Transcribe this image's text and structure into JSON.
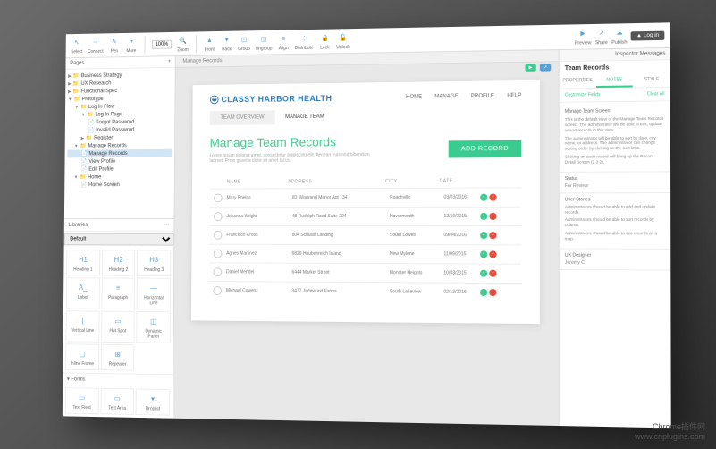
{
  "toolbar": {
    "select": "Select",
    "connect": "Connect",
    "pen": "Pen",
    "more": "More",
    "zoom_value": "100%",
    "zoom_label": "Zoom",
    "front": "Front",
    "back": "Back",
    "group": "Group",
    "ungroup": "Ungroup",
    "align": "Align",
    "distribute": "Distribute",
    "lock": "Lock",
    "unlock": "Unlock",
    "preview": "Preview",
    "share": "Share",
    "publish": "Publish",
    "login": "Log in"
  },
  "pages_header": "Pages",
  "tree": [
    {
      "label": "Business Strategy",
      "type": "folder",
      "level": 0
    },
    {
      "label": "UX Research",
      "type": "folder",
      "level": 0
    },
    {
      "label": "Functional Spec",
      "type": "folder",
      "level": 0
    },
    {
      "label": "Prototype",
      "type": "folder",
      "level": 0,
      "open": true
    },
    {
      "label": "Log In Flow",
      "type": "folder",
      "level": 1,
      "open": true
    },
    {
      "label": "Log In Page",
      "type": "folder",
      "level": 2,
      "open": true
    },
    {
      "label": "Forgot Password",
      "type": "page",
      "level": 3
    },
    {
      "label": "Invalid Password",
      "type": "page",
      "level": 3
    },
    {
      "label": "Register",
      "type": "folder",
      "level": 2
    },
    {
      "label": "Manage Records",
      "type": "folder",
      "level": 1,
      "open": true
    },
    {
      "label": "Manage Records",
      "type": "page",
      "level": 2,
      "selected": true
    },
    {
      "label": "View Profile",
      "type": "page",
      "level": 2
    },
    {
      "label": "Edit Profile",
      "type": "page",
      "level": 2
    },
    {
      "label": "Home",
      "type": "folder",
      "level": 1,
      "open": true
    },
    {
      "label": "Home Screen",
      "type": "page",
      "level": 2
    }
  ],
  "libraries_header": "Libraries",
  "lib_selected": "Default",
  "widgets": [
    {
      "label": "Heading 1",
      "icon": "H1"
    },
    {
      "label": "Heading 2",
      "icon": "H2"
    },
    {
      "label": "Heading 3",
      "icon": "H3"
    },
    {
      "label": "Label",
      "icon": "A_"
    },
    {
      "label": "Paragraph",
      "icon": "≡"
    },
    {
      "label": "Horizontal Line",
      "icon": "—"
    },
    {
      "label": "Vertical Line",
      "icon": "|"
    },
    {
      "label": "Hot Spot",
      "icon": "▭"
    },
    {
      "label": "Dynamic Panel",
      "icon": "◫"
    },
    {
      "label": "Inline Frame",
      "icon": "▢"
    },
    {
      "label": "Repeater",
      "icon": "⊞"
    },
    {
      "label": "",
      "icon": ""
    }
  ],
  "forms_header": "Forms",
  "forms_widgets": [
    {
      "label": "Text Field",
      "icon": "▭"
    },
    {
      "label": "Text Area",
      "icon": "▭"
    },
    {
      "label": "Droplist",
      "icon": "▾"
    }
  ],
  "breadcrumb": "Manage Records",
  "mockup": {
    "brand": "CLASSY HARBOR HEALTH",
    "nav": [
      "HOME",
      "MANAGE",
      "PROFILE",
      "HELP"
    ],
    "tabs": [
      {
        "label": "TEAM OVERVIEW",
        "active": false
      },
      {
        "label": "MANAGE TEAM",
        "active": true
      }
    ],
    "title": "Manage Team Records",
    "subtitle": "Lorem ipsum dolorsit amet, consectetur adipiscing elit. Aenean euismod bibendum laoreet. Proin gravida dolor sit amet lacus.",
    "add_button": "ADD RECORD",
    "columns": {
      "name": "NAME",
      "address": "ADDRESS",
      "city": "CITY",
      "date": "DATE"
    },
    "rows": [
      {
        "name": "Mary Phelps",
        "address": "83 Wingrand Manor Apt 134",
        "city": "Roachville",
        "date": "03/03/2016"
      },
      {
        "name": "Johanna Wright",
        "address": "48 Rudolph Road Suite 204",
        "city": "Hovermouth",
        "date": "12/19/2015"
      },
      {
        "name": "Francisco Cross",
        "address": "804 Schulist Landing",
        "city": "South Lowell",
        "date": "09/04/2016"
      },
      {
        "name": "Agnes Martinez",
        "address": "6829 Haubenreich Island",
        "city": "New Mylene",
        "date": "11/09/2015"
      },
      {
        "name": "Daniel Mendel",
        "address": "6444 Market Street",
        "city": "Monster Heights",
        "date": "10/03/2015"
      },
      {
        "name": "Michael Cowenz",
        "address": "3477 Jadewood Farms",
        "city": "South Lakeview",
        "date": "02/13/2016"
      }
    ]
  },
  "inspector": {
    "header": "Inspector  Messages",
    "title": "Team Records",
    "tabs": [
      "PROPERTIES",
      "NOTES",
      "STYLE"
    ],
    "customize": "Customize Fields",
    "clear": "Clear All",
    "section_title": "Manage Team Screen",
    "notes": [
      "This is the default view of the Manage Team Records screen. The administrator will be able to edit, update or sort records in this view.",
      "The administrator will be able to sort by date, city, name, or address. The administrator can change sorting order by clicking on the sort links.",
      "Clicking on each record will bring up the Record Detail Screen (2.3.2)."
    ],
    "status_label": "Status",
    "status_value": "For Review",
    "stories_label": "User Stories",
    "stories": [
      "Administrators should be able to add and update records.",
      "Administrators should be able to sort records by column.",
      "Administrators should be able to see records as a map."
    ],
    "designer_label": "UX Designer",
    "designer_value": "Jeremy C."
  },
  "watermark": {
    "line1": "Chrome插件网",
    "line2": "www.cnplugins.com"
  }
}
